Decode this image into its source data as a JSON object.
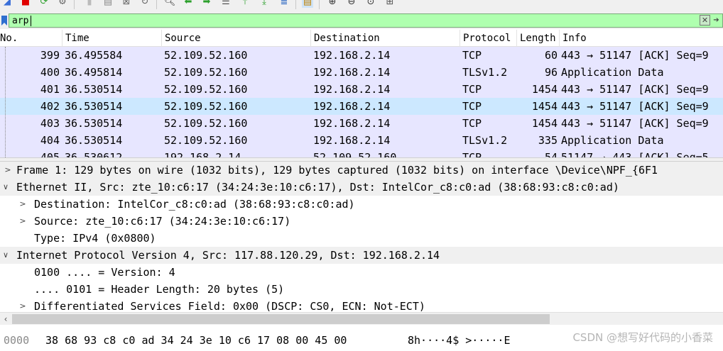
{
  "filter": {
    "value": "arp"
  },
  "packet_list": {
    "columns": [
      "No.",
      "Time",
      "Source",
      "Destination",
      "Protocol",
      "Length",
      "Info"
    ],
    "rows": [
      [
        "399",
        "36.495584",
        "52.109.52.160",
        "192.168.2.14",
        "TCP",
        "60",
        "443 → 51147 [ACK] Seq=9"
      ],
      [
        "400",
        "36.495814",
        "52.109.52.160",
        "192.168.2.14",
        "TLSv1.2",
        "96",
        "Application Data"
      ],
      [
        "401",
        "36.530514",
        "52.109.52.160",
        "192.168.2.14",
        "TCP",
        "1454",
        "443 → 51147 [ACK] Seq=9"
      ],
      [
        "402",
        "36.530514",
        "52.109.52.160",
        "192.168.2.14",
        "TCP",
        "1454",
        "443 → 51147 [ACK] Seq=9"
      ],
      [
        "403",
        "36.530514",
        "52.109.52.160",
        "192.168.2.14",
        "TCP",
        "1454",
        "443 → 51147 [ACK] Seq=9"
      ],
      [
        "404",
        "36.530514",
        "52.109.52.160",
        "192.168.2.14",
        "TLSv1.2",
        "335",
        "Application Data"
      ],
      [
        "405",
        "36.530612",
        "192.168.2.14",
        "52.109.52.160",
        "TCP",
        "54",
        "51147 → 443 [ACK] Seq=5"
      ]
    ],
    "selected_row_no": "402"
  },
  "details": [
    {
      "text": "Frame 1: 129 bytes on wire (1032 bits), 129 bytes captured (1032 bits) on interface \\Device\\NPF_{6F1",
      "arrow": ">"
    },
    {
      "text": "Ethernet II, Src: zte_10:c6:17 (34:24:3e:10:c6:17), Dst: IntelCor_c8:c0:ad (38:68:93:c8:c0:ad)",
      "arrow": "v"
    },
    {
      "text": "Destination: IntelCor_c8:c0:ad (38:68:93:c8:c0:ad)",
      "arrow": ">"
    },
    {
      "text": "Source: zte_10:c6:17 (34:24:3e:10:c6:17)",
      "arrow": ">"
    },
    {
      "text": "Type: IPv4 (0x0800)",
      "arrow": ""
    },
    {
      "text": "Internet Protocol Version 4, Src: 117.88.120.29, Dst: 192.168.2.14",
      "arrow": "v"
    },
    {
      "text": "0100 .... = Version: 4",
      "arrow": ""
    },
    {
      "text": ".... 0101 = Header Length: 20 bytes (5)",
      "arrow": ""
    },
    {
      "text": "Differentiated Services Field: 0x00 (DSCP: CS0, ECN: Not-ECT)",
      "arrow": ">"
    }
  ],
  "bytes": {
    "offset": "0000",
    "hex": "38 68 93 c8 c0 ad 34 24  3e 10 c6 17 08 00 45 00",
    "ascii": "8h····4$ >·····E"
  },
  "watermark": "CSDN @想写好代码的小香菜",
  "colors": {
    "filter_valid_bg": "#afffaf",
    "row_bg": "#e7e6ff",
    "selected_row_bg": "#cce8ff",
    "toolbar_bg": "#f0f0f0"
  },
  "toolbar_icons": [
    "start-capture-icon",
    "stop-capture-icon",
    "restart-capture-icon",
    "capture-options-icon",
    "open-file-icon",
    "save-file-icon",
    "close-file-icon",
    "reload-file-icon",
    "find-packet-icon",
    "go-back-icon",
    "go-forward-icon",
    "go-to-packet-icon",
    "go-first-icon",
    "go-last-icon",
    "auto-scroll-icon",
    "colorize-icon",
    "zoom-in-icon",
    "zoom-out-icon",
    "zoom-normal-icon",
    "resize-columns-icon"
  ]
}
